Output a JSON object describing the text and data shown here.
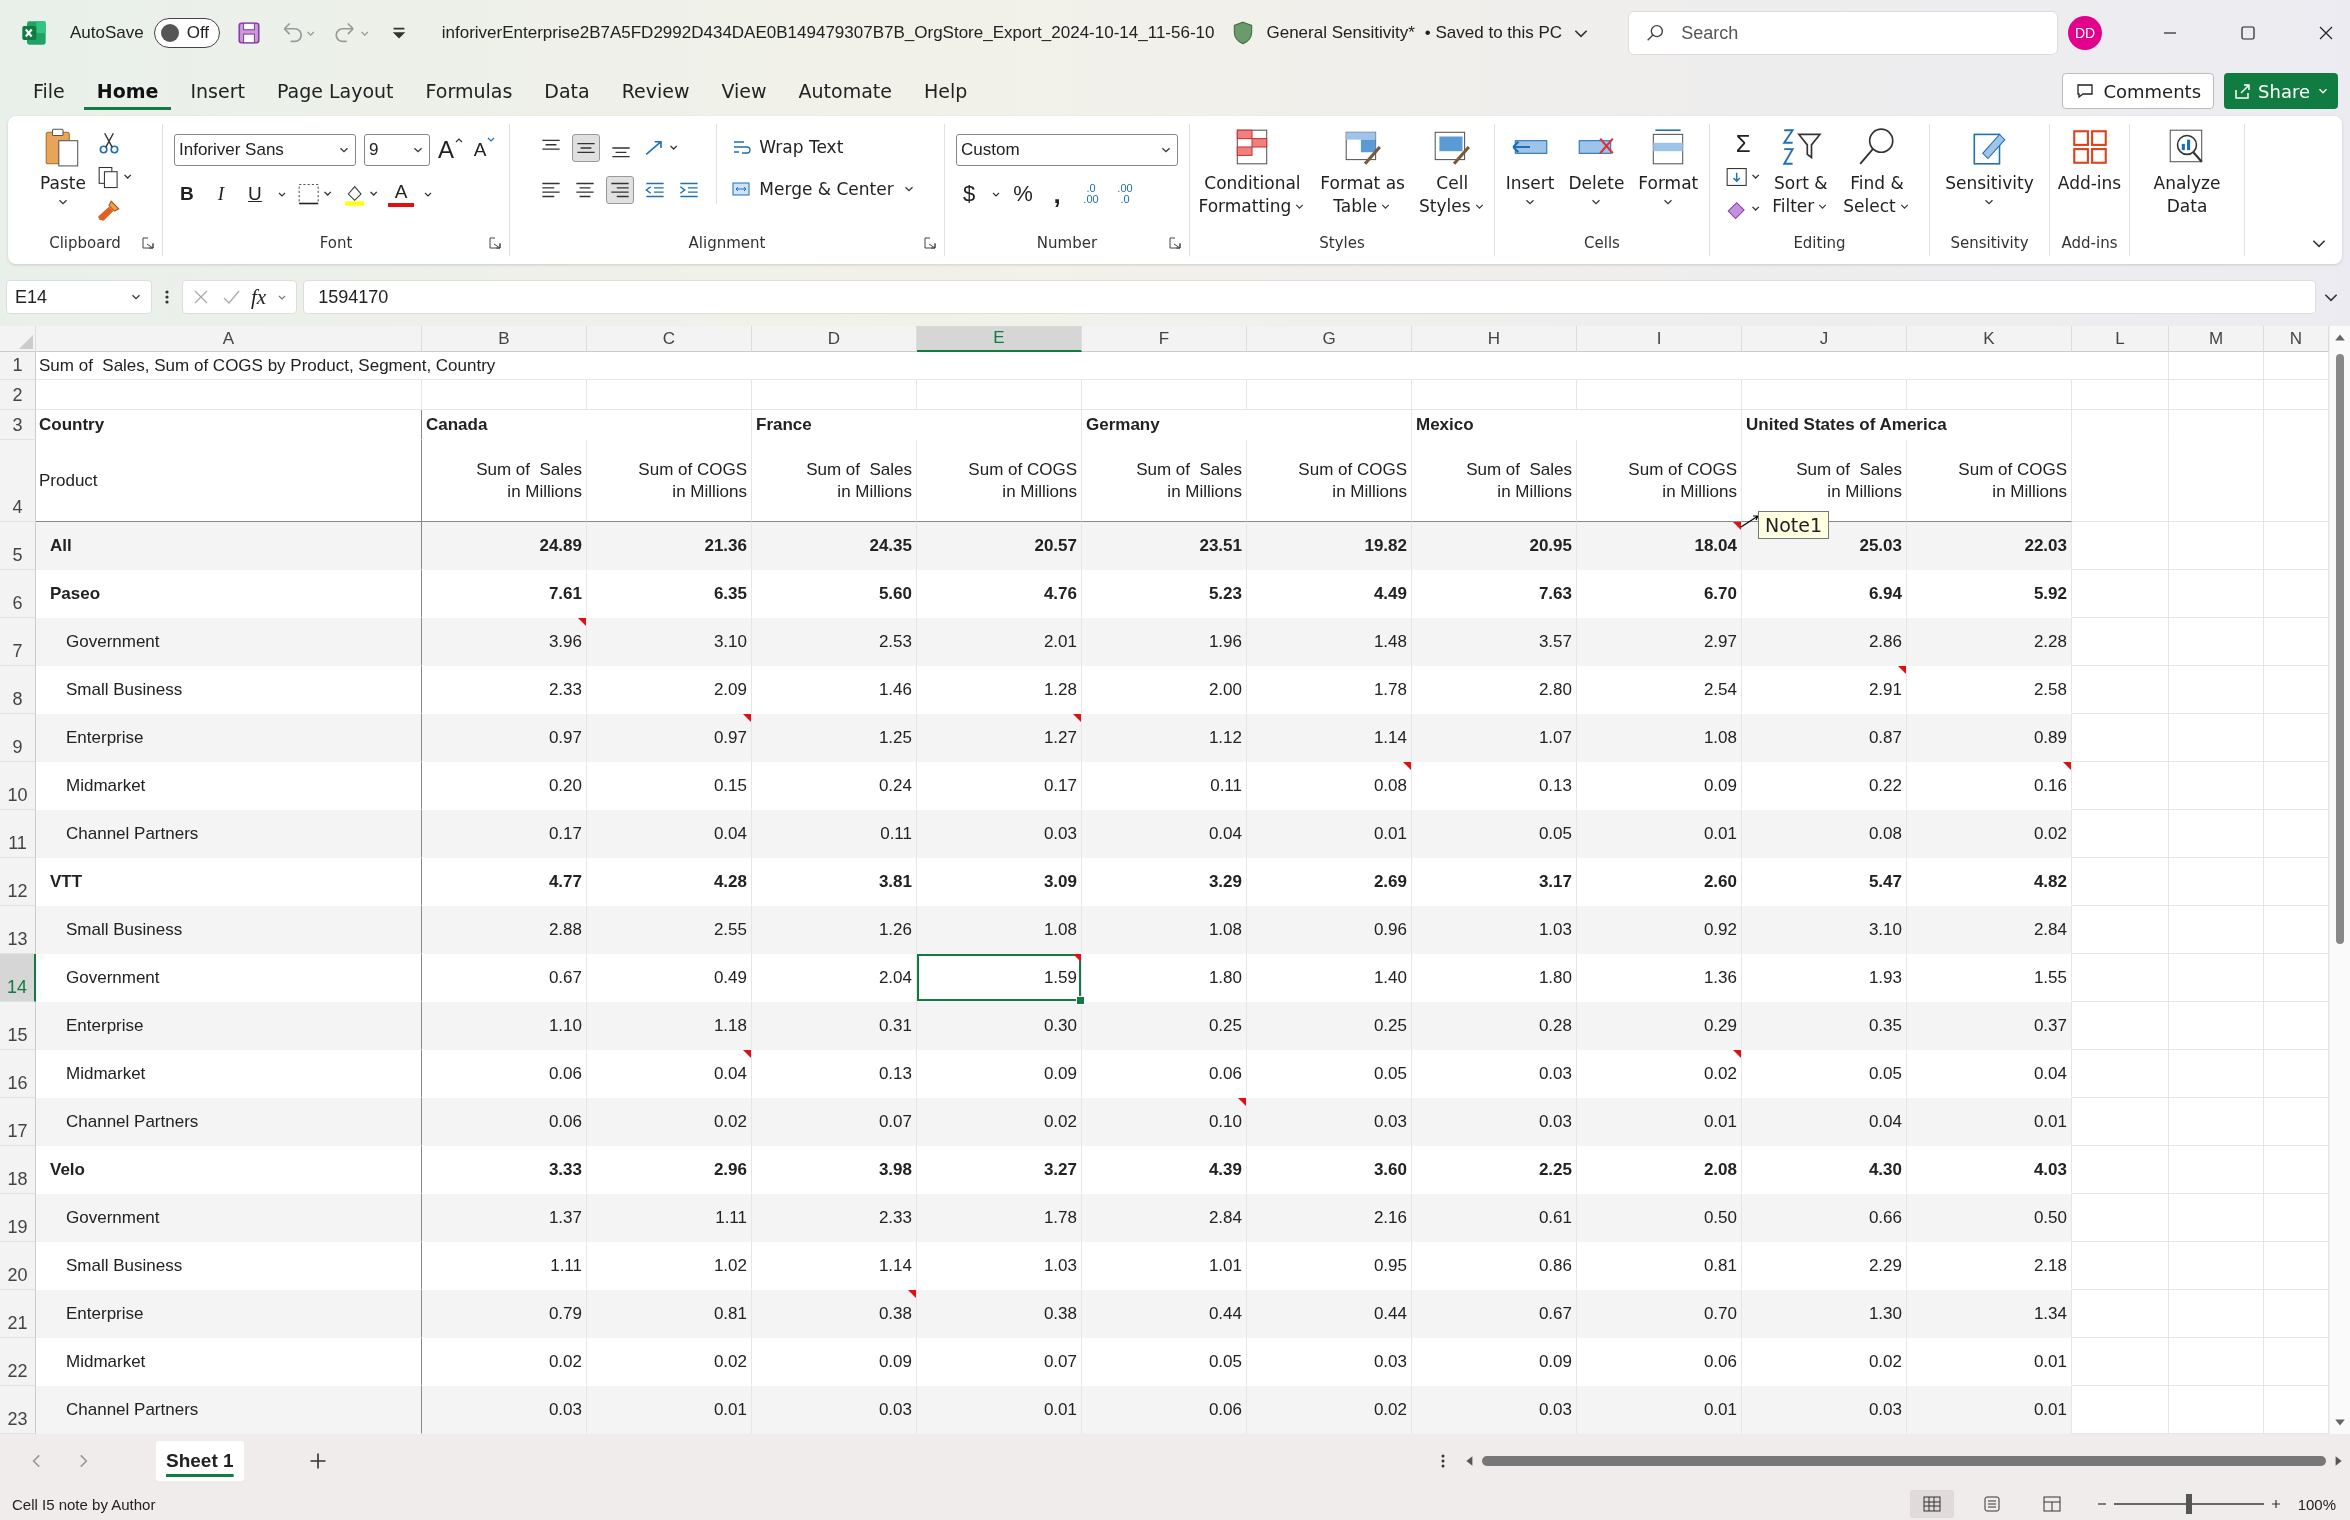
{
  "title_bar": {
    "autosave_label": "AutoSave",
    "autosave_on": false,
    "autosave_state": "Off",
    "file_name": "inforiverEnterprise2B7A5FD2992D434DAE0B149479307B7B_OrgStore_Export_2024-10-14_11-56-10",
    "sensitivity": "General Sensitivity*",
    "save_status": "• Saved to this PC",
    "search_placeholder": "Search",
    "avatar": "DD"
  },
  "menu_tabs": [
    {
      "label": "File",
      "selected": false
    },
    {
      "label": "Home",
      "selected": true
    },
    {
      "label": "Insert",
      "selected": false
    },
    {
      "label": "Page Layout",
      "selected": false
    },
    {
      "label": "Formulas",
      "selected": false
    },
    {
      "label": "Data",
      "selected": false
    },
    {
      "label": "Review",
      "selected": false
    },
    {
      "label": "View",
      "selected": false
    },
    {
      "label": "Automate",
      "selected": false
    },
    {
      "label": "Help",
      "selected": false
    }
  ],
  "comments_button": "Comments",
  "share_button": "Share",
  "ribbon": [
    {
      "name": "Clipboard",
      "launcher": true,
      "kind": "clipboard",
      "paste": "Paste"
    },
    {
      "name": "Font",
      "launcher": true,
      "kind": "font",
      "font": "Inforiver Sans",
      "size": "9",
      "grow": "A",
      "shrink": "A",
      "bold": "B",
      "italic": "I",
      "underline": "U",
      "color_glyph": "A"
    },
    {
      "name": "Alignment",
      "launcher": true,
      "kind": "alignment",
      "wrap": "Wrap Text",
      "merge": "Merge & Center"
    },
    {
      "name": "Number",
      "launcher": true,
      "kind": "number",
      "format": "Custom",
      "currency": "$",
      "percent": "%",
      "comma": ",",
      "decrease": [
        ".0",
        ".00"
      ],
      "increase": [
        ".00",
        ".0"
      ]
    },
    {
      "name": "Styles",
      "launcher": false,
      "kind": "buttons",
      "buttons": [
        {
          "kind": "conditional",
          "lines": [
            "Conditional",
            "Formatting"
          ],
          "dropdown": true
        },
        {
          "kind": "table",
          "lines": [
            "Format as",
            "Table"
          ],
          "dropdown": true
        },
        {
          "kind": "cell-styles",
          "lines": [
            "Cell",
            "Styles"
          ],
          "dropdown": true
        }
      ]
    },
    {
      "name": "Cells",
      "launcher": false,
      "kind": "buttons",
      "buttons": [
        {
          "kind": "insert",
          "lines": [
            "Insert"
          ],
          "dropdown": true
        },
        {
          "kind": "delete",
          "lines": [
            "Delete"
          ],
          "dropdown": true
        },
        {
          "kind": "format",
          "lines": [
            "Format"
          ],
          "dropdown": true
        }
      ]
    },
    {
      "name": "Editing",
      "launcher": false,
      "kind": "editing",
      "sum": "Σ",
      "buttons": [
        {
          "kind": "sort",
          "lines": [
            "Sort &",
            "Filter"
          ],
          "dropdown": true
        },
        {
          "kind": "find",
          "lines": [
            "Find &",
            "Select"
          ],
          "dropdown": true
        }
      ]
    },
    {
      "name": "Sensitivity",
      "launcher": false,
      "kind": "buttons",
      "buttons": [
        {
          "kind": "sensitivity",
          "lines": [
            "Sensitivity"
          ],
          "dropdown": true
        }
      ]
    },
    {
      "name": "Add-ins",
      "launcher": false,
      "kind": "buttons",
      "buttons": [
        {
          "kind": "addins",
          "lines": [
            "Add-ins"
          ],
          "dropdown": false
        }
      ]
    },
    {
      "launcher": false,
      "kind": "buttons",
      "buttons": [
        {
          "kind": "analyze",
          "lines": [
            "Analyze",
            "Data"
          ],
          "dropdown": false
        }
      ]
    }
  ],
  "name_box": "E14",
  "fx": "fx",
  "formula": "1594170",
  "sheet": {
    "columns": [
      "A",
      "B",
      "C",
      "D",
      "E",
      "F",
      "G",
      "H",
      "I",
      "J",
      "K",
      "L",
      "M",
      "N"
    ],
    "title_row": {
      "row": "1",
      "text": "Sum of  Sales, Sum of COGS by Product, Segment, Country"
    },
    "blank_row": {
      "row": "2"
    },
    "country_row": {
      "row": "3",
      "label": "Country",
      "countries": [
        "Canada",
        "France",
        "Germany",
        "Mexico",
        "United States of America"
      ]
    },
    "measure_row": {
      "row": "4",
      "label": "Product",
      "measures": [
        "Sum of  Sales\nin Millions",
        "Sum of COGS\nin Millions",
        "Sum of  Sales\nin Millions",
        "Sum of COGS\nin Millions",
        "Sum of  Sales\nin Millions",
        "Sum of COGS\nin Millions",
        "Sum of  Sales\nin Millions",
        "Sum of COGS\nin Millions",
        "Sum of  Sales\nin Millions",
        "Sum of COGS\nin Millions"
      ]
    },
    "rows": [
      {
        "row": "5",
        "kind": "product",
        "label": "All",
        "cells": [
          {
            "v": "24.89",
            "note": false,
            "selected": false
          },
          {
            "v": "21.36",
            "note": false,
            "selected": false
          },
          {
            "v": "24.35",
            "note": false,
            "selected": false
          },
          {
            "v": "20.57",
            "note": false,
            "selected": false
          },
          {
            "v": "23.51",
            "note": false,
            "selected": false
          },
          {
            "v": "19.82",
            "note": false,
            "selected": false
          },
          {
            "v": "20.95",
            "note": false,
            "selected": false
          },
          {
            "v": "18.04",
            "note": true,
            "selected": false
          },
          {
            "v": "25.03",
            "note": false,
            "selected": false
          },
          {
            "v": "22.03",
            "note": false,
            "selected": false
          }
        ]
      },
      {
        "row": "6",
        "kind": "product",
        "label": "Paseo",
        "cells": [
          {
            "v": "7.61",
            "note": false,
            "selected": false
          },
          {
            "v": "6.35",
            "note": false,
            "selected": false
          },
          {
            "v": "5.60",
            "note": false,
            "selected": false
          },
          {
            "v": "4.76",
            "note": false,
            "selected": false
          },
          {
            "v": "5.23",
            "note": false,
            "selected": false
          },
          {
            "v": "4.49",
            "note": false,
            "selected": false
          },
          {
            "v": "7.63",
            "note": false,
            "selected": false
          },
          {
            "v": "6.70",
            "note": false,
            "selected": false
          },
          {
            "v": "6.94",
            "note": false,
            "selected": false
          },
          {
            "v": "5.92",
            "note": false,
            "selected": false
          }
        ]
      },
      {
        "row": "7",
        "kind": "segment",
        "label": "Government",
        "cells": [
          {
            "v": "3.96",
            "note": true,
            "selected": false
          },
          {
            "v": "3.10",
            "note": false,
            "selected": false
          },
          {
            "v": "2.53",
            "note": false,
            "selected": false
          },
          {
            "v": "2.01",
            "note": false,
            "selected": false
          },
          {
            "v": "1.96",
            "note": false,
            "selected": false
          },
          {
            "v": "1.48",
            "note": false,
            "selected": false
          },
          {
            "v": "3.57",
            "note": false,
            "selected": false
          },
          {
            "v": "2.97",
            "note": false,
            "selected": false
          },
          {
            "v": "2.86",
            "note": false,
            "selected": false
          },
          {
            "v": "2.28",
            "note": false,
            "selected": false
          }
        ]
      },
      {
        "row": "8",
        "kind": "segment",
        "label": "Small Business",
        "cells": [
          {
            "v": "2.33",
            "note": false,
            "selected": false
          },
          {
            "v": "2.09",
            "note": false,
            "selected": false
          },
          {
            "v": "1.46",
            "note": false,
            "selected": false
          },
          {
            "v": "1.28",
            "note": false,
            "selected": false
          },
          {
            "v": "2.00",
            "note": false,
            "selected": false
          },
          {
            "v": "1.78",
            "note": false,
            "selected": false
          },
          {
            "v": "2.80",
            "note": false,
            "selected": false
          },
          {
            "v": "2.54",
            "note": false,
            "selected": false
          },
          {
            "v": "2.91",
            "note": true,
            "selected": false
          },
          {
            "v": "2.58",
            "note": false,
            "selected": false
          }
        ]
      },
      {
        "row": "9",
        "kind": "segment",
        "label": "Enterprise",
        "cells": [
          {
            "v": "0.97",
            "note": false,
            "selected": false
          },
          {
            "v": "0.97",
            "note": true,
            "selected": false
          },
          {
            "v": "1.25",
            "note": false,
            "selected": false
          },
          {
            "v": "1.27",
            "note": true,
            "selected": false
          },
          {
            "v": "1.12",
            "note": false,
            "selected": false
          },
          {
            "v": "1.14",
            "note": false,
            "selected": false
          },
          {
            "v": "1.07",
            "note": false,
            "selected": false
          },
          {
            "v": "1.08",
            "note": false,
            "selected": false
          },
          {
            "v": "0.87",
            "note": false,
            "selected": false
          },
          {
            "v": "0.89",
            "note": false,
            "selected": false
          }
        ]
      },
      {
        "row": "10",
        "kind": "segment",
        "label": "Midmarket",
        "cells": [
          {
            "v": "0.20",
            "note": false,
            "selected": false
          },
          {
            "v": "0.15",
            "note": false,
            "selected": false
          },
          {
            "v": "0.24",
            "note": false,
            "selected": false
          },
          {
            "v": "0.17",
            "note": false,
            "selected": false
          },
          {
            "v": "0.11",
            "note": false,
            "selected": false
          },
          {
            "v": "0.08",
            "note": true,
            "selected": false
          },
          {
            "v": "0.13",
            "note": false,
            "selected": false
          },
          {
            "v": "0.09",
            "note": false,
            "selected": false
          },
          {
            "v": "0.22",
            "note": false,
            "selected": false
          },
          {
            "v": "0.16",
            "note": true,
            "selected": false
          }
        ]
      },
      {
        "row": "11",
        "kind": "segment",
        "label": "Channel Partners",
        "cells": [
          {
            "v": "0.17",
            "note": false,
            "selected": false
          },
          {
            "v": "0.04",
            "note": false,
            "selected": false
          },
          {
            "v": "0.11",
            "note": false,
            "selected": false
          },
          {
            "v": "0.03",
            "note": false,
            "selected": false
          },
          {
            "v": "0.04",
            "note": false,
            "selected": false
          },
          {
            "v": "0.01",
            "note": false,
            "selected": false
          },
          {
            "v": "0.05",
            "note": false,
            "selected": false
          },
          {
            "v": "0.01",
            "note": false,
            "selected": false
          },
          {
            "v": "0.08",
            "note": false,
            "selected": false
          },
          {
            "v": "0.02",
            "note": false,
            "selected": false
          }
        ]
      },
      {
        "row": "12",
        "kind": "product",
        "label": "VTT",
        "cells": [
          {
            "v": "4.77",
            "note": false,
            "selected": false
          },
          {
            "v": "4.28",
            "note": false,
            "selected": false
          },
          {
            "v": "3.81",
            "note": false,
            "selected": false
          },
          {
            "v": "3.09",
            "note": false,
            "selected": false
          },
          {
            "v": "3.29",
            "note": false,
            "selected": false
          },
          {
            "v": "2.69",
            "note": false,
            "selected": false
          },
          {
            "v": "3.17",
            "note": false,
            "selected": false
          },
          {
            "v": "2.60",
            "note": false,
            "selected": false
          },
          {
            "v": "5.47",
            "note": false,
            "selected": false
          },
          {
            "v": "4.82",
            "note": false,
            "selected": false
          }
        ]
      },
      {
        "row": "13",
        "kind": "segment",
        "label": "Small Business",
        "cells": [
          {
            "v": "2.88",
            "note": false,
            "selected": false
          },
          {
            "v": "2.55",
            "note": false,
            "selected": false
          },
          {
            "v": "1.26",
            "note": false,
            "selected": false
          },
          {
            "v": "1.08",
            "note": false,
            "selected": false
          },
          {
            "v": "1.08",
            "note": false,
            "selected": false
          },
          {
            "v": "0.96",
            "note": false,
            "selected": false
          },
          {
            "v": "1.03",
            "note": false,
            "selected": false
          },
          {
            "v": "0.92",
            "note": false,
            "selected": false
          },
          {
            "v": "3.10",
            "note": false,
            "selected": false
          },
          {
            "v": "2.84",
            "note": false,
            "selected": false
          }
        ]
      },
      {
        "row": "14",
        "kind": "segment",
        "label": "Government",
        "cells": [
          {
            "v": "0.67",
            "note": false,
            "selected": false
          },
          {
            "v": "0.49",
            "note": false,
            "selected": false
          },
          {
            "v": "2.04",
            "note": false,
            "selected": false
          },
          {
            "v": "1.59",
            "note": true,
            "selected": true
          },
          {
            "v": "1.80",
            "note": false,
            "selected": false
          },
          {
            "v": "1.40",
            "note": false,
            "selected": false
          },
          {
            "v": "1.80",
            "note": false,
            "selected": false
          },
          {
            "v": "1.36",
            "note": false,
            "selected": false
          },
          {
            "v": "1.93",
            "note": false,
            "selected": false
          },
          {
            "v": "1.55",
            "note": false,
            "selected": false
          }
        ]
      },
      {
        "row": "15",
        "kind": "segment",
        "label": "Enterprise",
        "cells": [
          {
            "v": "1.10",
            "note": false,
            "selected": false
          },
          {
            "v": "1.18",
            "note": false,
            "selected": false
          },
          {
            "v": "0.31",
            "note": false,
            "selected": false
          },
          {
            "v": "0.30",
            "note": false,
            "selected": false
          },
          {
            "v": "0.25",
            "note": false,
            "selected": false
          },
          {
            "v": "0.25",
            "note": false,
            "selected": false
          },
          {
            "v": "0.28",
            "note": false,
            "selected": false
          },
          {
            "v": "0.29",
            "note": false,
            "selected": false
          },
          {
            "v": "0.35",
            "note": false,
            "selected": false
          },
          {
            "v": "0.37",
            "note": false,
            "selected": false
          }
        ]
      },
      {
        "row": "16",
        "kind": "segment",
        "label": "Midmarket",
        "cells": [
          {
            "v": "0.06",
            "note": false,
            "selected": false
          },
          {
            "v": "0.04",
            "note": true,
            "selected": false
          },
          {
            "v": "0.13",
            "note": false,
            "selected": false
          },
          {
            "v": "0.09",
            "note": false,
            "selected": false
          },
          {
            "v": "0.06",
            "note": false,
            "selected": false
          },
          {
            "v": "0.05",
            "note": false,
            "selected": false
          },
          {
            "v": "0.03",
            "note": false,
            "selected": false
          },
          {
            "v": "0.02",
            "note": true,
            "selected": false
          },
          {
            "v": "0.05",
            "note": false,
            "selected": false
          },
          {
            "v": "0.04",
            "note": false,
            "selected": false
          }
        ]
      },
      {
        "row": "17",
        "kind": "segment",
        "label": "Channel Partners",
        "cells": [
          {
            "v": "0.06",
            "note": false,
            "selected": false
          },
          {
            "v": "0.02",
            "note": false,
            "selected": false
          },
          {
            "v": "0.07",
            "note": false,
            "selected": false
          },
          {
            "v": "0.02",
            "note": false,
            "selected": false
          },
          {
            "v": "0.10",
            "note": true,
            "selected": false
          },
          {
            "v": "0.03",
            "note": false,
            "selected": false
          },
          {
            "v": "0.03",
            "note": false,
            "selected": false
          },
          {
            "v": "0.01",
            "note": false,
            "selected": false
          },
          {
            "v": "0.04",
            "note": false,
            "selected": false
          },
          {
            "v": "0.01",
            "note": false,
            "selected": false
          }
        ]
      },
      {
        "row": "18",
        "kind": "product",
        "label": "Velo",
        "cells": [
          {
            "v": "3.33",
            "note": false,
            "selected": false
          },
          {
            "v": "2.96",
            "note": false,
            "selected": false
          },
          {
            "v": "3.98",
            "note": false,
            "selected": false
          },
          {
            "v": "3.27",
            "note": false,
            "selected": false
          },
          {
            "v": "4.39",
            "note": false,
            "selected": false
          },
          {
            "v": "3.60",
            "note": false,
            "selected": false
          },
          {
            "v": "2.25",
            "note": false,
            "selected": false
          },
          {
            "v": "2.08",
            "note": false,
            "selected": false
          },
          {
            "v": "4.30",
            "note": false,
            "selected": false
          },
          {
            "v": "4.03",
            "note": false,
            "selected": false
          }
        ]
      },
      {
        "row": "19",
        "kind": "segment",
        "label": "Government",
        "cells": [
          {
            "v": "1.37",
            "note": false,
            "selected": false
          },
          {
            "v": "1.11",
            "note": false,
            "selected": false
          },
          {
            "v": "2.33",
            "note": false,
            "selected": false
          },
          {
            "v": "1.78",
            "note": false,
            "selected": false
          },
          {
            "v": "2.84",
            "note": false,
            "selected": false
          },
          {
            "v": "2.16",
            "note": false,
            "selected": false
          },
          {
            "v": "0.61",
            "note": false,
            "selected": false
          },
          {
            "v": "0.50",
            "note": false,
            "selected": false
          },
          {
            "v": "0.66",
            "note": false,
            "selected": false
          },
          {
            "v": "0.50",
            "note": false,
            "selected": false
          }
        ]
      },
      {
        "row": "20",
        "kind": "segment",
        "label": "Small Business",
        "cells": [
          {
            "v": "1.11",
            "note": false,
            "selected": false
          },
          {
            "v": "1.02",
            "note": false,
            "selected": false
          },
          {
            "v": "1.14",
            "note": false,
            "selected": false
          },
          {
            "v": "1.03",
            "note": false,
            "selected": false
          },
          {
            "v": "1.01",
            "note": false,
            "selected": false
          },
          {
            "v": "0.95",
            "note": false,
            "selected": false
          },
          {
            "v": "0.86",
            "note": false,
            "selected": false
          },
          {
            "v": "0.81",
            "note": false,
            "selected": false
          },
          {
            "v": "2.29",
            "note": false,
            "selected": false
          },
          {
            "v": "2.18",
            "note": false,
            "selected": false
          }
        ]
      },
      {
        "row": "21",
        "kind": "segment",
        "label": "Enterprise",
        "cells": [
          {
            "v": "0.79",
            "note": false,
            "selected": false
          },
          {
            "v": "0.81",
            "note": false,
            "selected": false
          },
          {
            "v": "0.38",
            "note": true,
            "selected": false
          },
          {
            "v": "0.38",
            "note": false,
            "selected": false
          },
          {
            "v": "0.44",
            "note": false,
            "selected": false
          },
          {
            "v": "0.44",
            "note": false,
            "selected": false
          },
          {
            "v": "0.67",
            "note": false,
            "selected": false
          },
          {
            "v": "0.70",
            "note": false,
            "selected": false
          },
          {
            "v": "1.30",
            "note": false,
            "selected": false
          },
          {
            "v": "1.34",
            "note": false,
            "selected": false
          }
        ]
      },
      {
        "row": "22",
        "kind": "segment",
        "label": "Midmarket",
        "cells": [
          {
            "v": "0.02",
            "note": false,
            "selected": false
          },
          {
            "v": "0.02",
            "note": false,
            "selected": false
          },
          {
            "v": "0.09",
            "note": false,
            "selected": false
          },
          {
            "v": "0.07",
            "note": false,
            "selected": false
          },
          {
            "v": "0.05",
            "note": false,
            "selected": false
          },
          {
            "v": "0.03",
            "note": false,
            "selected": false
          },
          {
            "v": "0.09",
            "note": false,
            "selected": false
          },
          {
            "v": "0.06",
            "note": false,
            "selected": false
          },
          {
            "v": "0.02",
            "note": false,
            "selected": false
          },
          {
            "v": "0.01",
            "note": false,
            "selected": false
          }
        ]
      },
      {
        "row": "23",
        "kind": "segment",
        "label": "Channel Partners",
        "cells": [
          {
            "v": "0.03",
            "note": false,
            "selected": false
          },
          {
            "v": "0.01",
            "note": false,
            "selected": false
          },
          {
            "v": "0.03",
            "note": false,
            "selected": false
          },
          {
            "v": "0.01",
            "note": false,
            "selected": false
          },
          {
            "v": "0.06",
            "note": false,
            "selected": false
          },
          {
            "v": "0.02",
            "note": false,
            "selected": false
          },
          {
            "v": "0.03",
            "note": false,
            "selected": false
          },
          {
            "v": "0.01",
            "note": false,
            "selected": false
          },
          {
            "v": "0.03",
            "note": false,
            "selected": false
          },
          {
            "v": "0.01",
            "note": false,
            "selected": false
          }
        ]
      }
    ]
  },
  "note_popup": "Note1",
  "sheet_tabs": [
    {
      "label": "Sheet 1",
      "selected": true
    }
  ],
  "status": {
    "text": "Cell I5 note by Author",
    "views": [
      {
        "kind": "normal",
        "selected": true
      },
      {
        "kind": "page-layout",
        "selected": false
      },
      {
        "kind": "page-break",
        "selected": false
      }
    ],
    "zoom": {
      "level": 0.5
    },
    "zoom_text": "100%"
  }
}
